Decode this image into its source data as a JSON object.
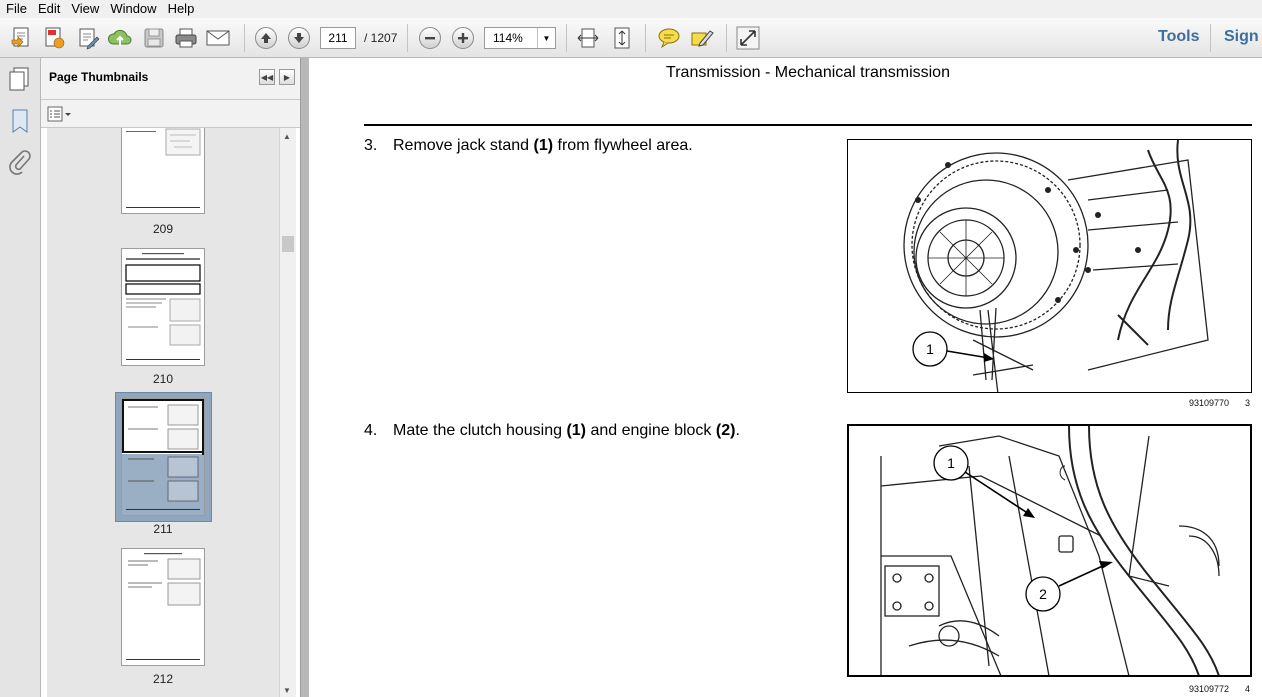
{
  "menu": [
    "File",
    "Edit",
    "View",
    "Window",
    "Help"
  ],
  "toolbar": {
    "current_page": "211",
    "page_total": "/ 1207",
    "zoom": "114%",
    "tools_label": "Tools",
    "sign_label": "Sign"
  },
  "panel": {
    "title": "Page Thumbnails",
    "thumbnails": [
      {
        "label": "209"
      },
      {
        "label": "210"
      },
      {
        "label": "211"
      },
      {
        "label": "212"
      }
    ]
  },
  "document": {
    "header": "Transmission - Mechanical transmission",
    "steps": [
      {
        "number": "3.",
        "text_before": "Remove jack stand ",
        "bold1": "(1)",
        "text_after": " from flywheel area.",
        "figure_id": "93109770",
        "figure_index": "3",
        "callouts": [
          "1"
        ]
      },
      {
        "number": "4.",
        "text_before": "Mate the clutch housing ",
        "bold1": "(1)",
        "text_mid": " and engine block ",
        "bold2": "(2)",
        "text_after": ".",
        "figure_id": "93109772",
        "figure_index": "4",
        "callouts": [
          "1",
          "2"
        ]
      }
    ]
  }
}
